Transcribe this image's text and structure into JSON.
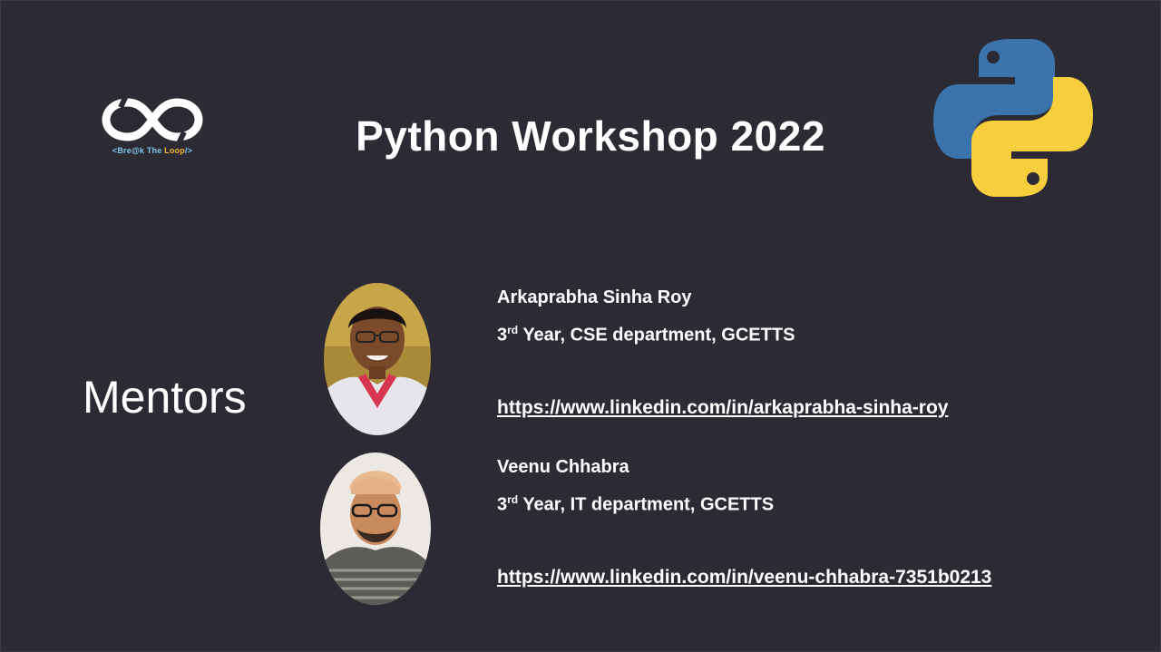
{
  "slide": {
    "title": "Python Workshop 2022",
    "logo": {
      "icon": "infinity-broken-loop",
      "caption_prefix": "<Bre@k The ",
      "caption_highlight": "Loop",
      "caption_suffix": "/>"
    },
    "python_logo_icon": "python-logo",
    "section_heading": "Mentors",
    "mentors": [
      {
        "name": "Arkaprabha Sinha Roy",
        "year_number": "3",
        "year_suffix": "rd",
        "year_detail": " Year, CSE department, GCETTS",
        "linkedin": "https://www.linkedin.com/in/arkaprabha-sinha-roy"
      },
      {
        "name": "Veenu Chhabra",
        "year_number": "3",
        "year_suffix": "rd",
        "year_detail": " Year, IT department, GCETTS",
        "linkedin": "https://www.linkedin.com/in/veenu-chhabra-7351b0213"
      }
    ]
  },
  "colors": {
    "background": "#2c2a33",
    "python_blue": "#3a74ab",
    "python_yellow": "#f7cf3d",
    "logo_blue": "#7fc6e8",
    "logo_orange": "#f5b335"
  }
}
